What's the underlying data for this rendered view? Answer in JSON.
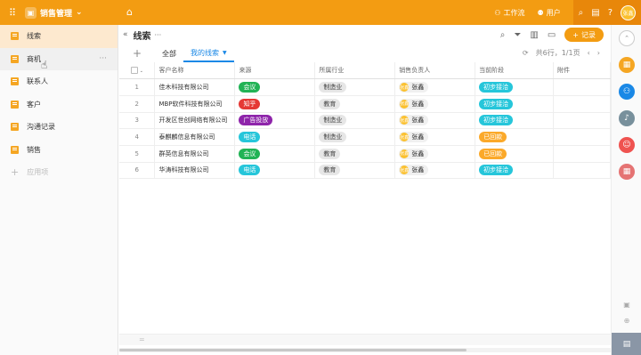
{
  "topbar": {
    "app_name": "销售管理",
    "links": [
      {
        "icon": "sitemap-icon",
        "label": "工作流"
      },
      {
        "icon": "users-icon",
        "label": "用户"
      }
    ],
    "avatar_initials": "张鑫"
  },
  "sidebar": {
    "items": [
      {
        "label": "线索"
      },
      {
        "label": "商机"
      },
      {
        "label": "联系人"
      },
      {
        "label": "客户"
      },
      {
        "label": "沟通记录"
      },
      {
        "label": "销售"
      }
    ],
    "add_label": "应用项",
    "more": "···"
  },
  "main": {
    "title": "线索",
    "title_more": "···",
    "add_record": "记录",
    "tabs": [
      {
        "label": "全部"
      },
      {
        "label": "我的线索"
      }
    ],
    "pager_text": "共6行，1/1页"
  },
  "table": {
    "columns": [
      "客户名称",
      "来源",
      "所属行业",
      "销售负责人",
      "当前阶段",
      "附件"
    ],
    "rows": [
      {
        "num": "1",
        "name": "佳木科技有限公司",
        "source": "会议",
        "industry": "制造业",
        "owner": "张鑫",
        "stage": "初步接洽"
      },
      {
        "num": "2",
        "name": "MBP软件科技有限公司",
        "source": "知乎",
        "industry": "教育",
        "owner": "张鑫",
        "stage": "初步接洽"
      },
      {
        "num": "3",
        "name": "开发区世创网络有限公司",
        "source": "广告投放",
        "industry": "制造业",
        "owner": "张鑫",
        "stage": "初步接洽"
      },
      {
        "num": "4",
        "name": "泰麒麟信息有限公司",
        "source": "电话",
        "industry": "制造业",
        "owner": "张鑫",
        "stage": "已回款"
      },
      {
        "num": "5",
        "name": "群英信息有限公司",
        "source": "会议",
        "industry": "教育",
        "owner": "张鑫",
        "stage": "已回款"
      },
      {
        "num": "6",
        "name": "华涛科技有限公司",
        "source": "电话",
        "industry": "教育",
        "owner": "张鑫",
        "stage": "初步接洽"
      }
    ],
    "source_colors": {
      "会议": "#21b355",
      "知乎": "#e53935",
      "广告投放": "#8e24aa",
      "电话": "#26c6da"
    },
    "stage_colors": {
      "初步接洽": "#26c6da",
      "已回款": "#fba92a"
    },
    "owner_avatar": "张鑫"
  },
  "footer": {
    "label": "="
  },
  "colors": {
    "accent": "#f39c12",
    "link": "#1a88e6"
  }
}
